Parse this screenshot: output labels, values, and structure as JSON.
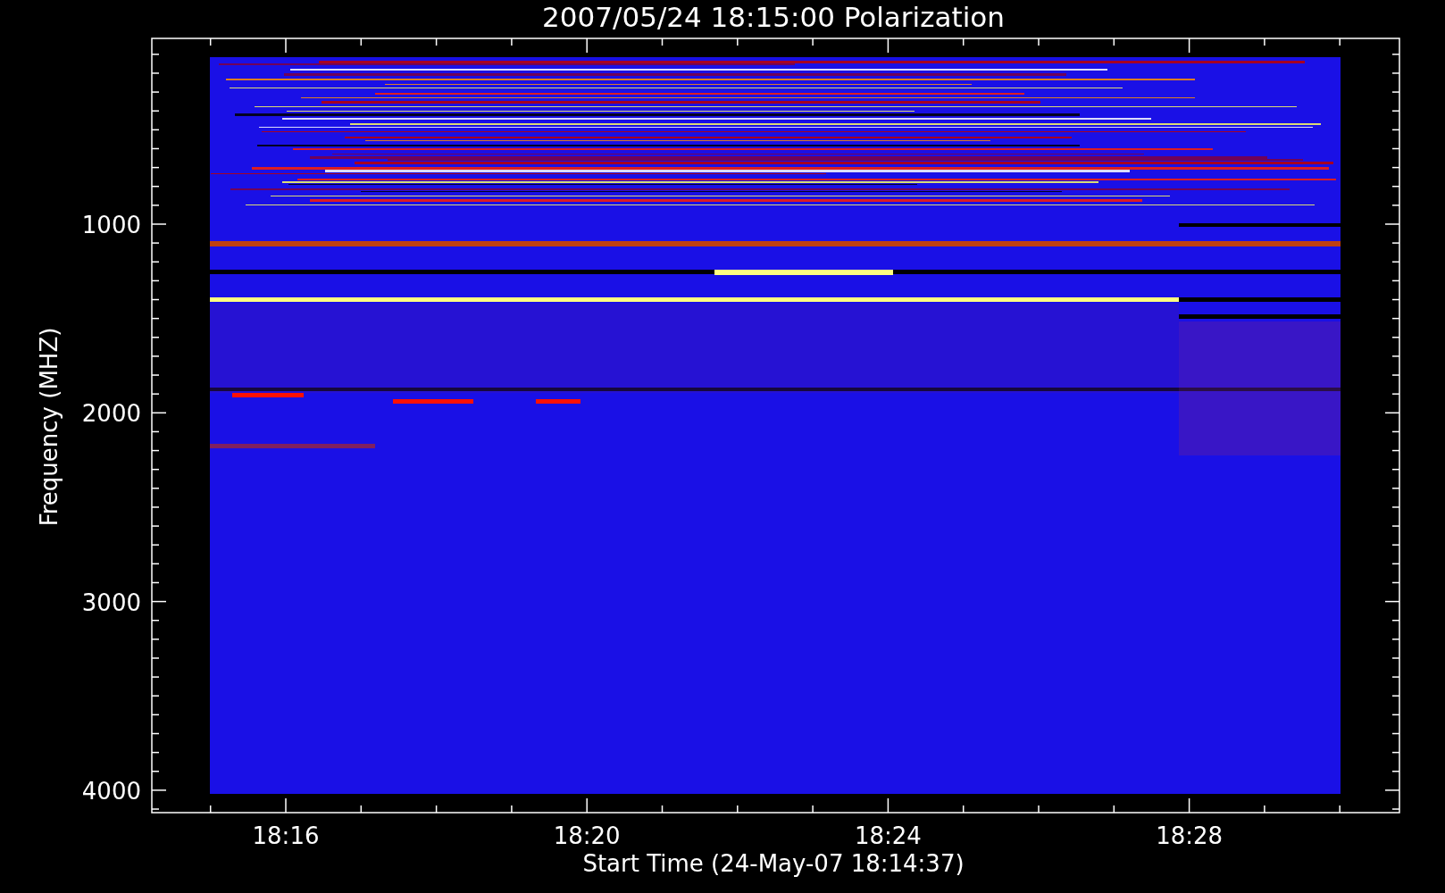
{
  "title": "2007/05/24 18:15:00 Polarization",
  "y_axis": {
    "label": "Frequency (MHZ)",
    "ticks": [
      "1000",
      "2000",
      "3000",
      "4000"
    ]
  },
  "x_axis": {
    "label": "Start Time (24-May-07 18:14:37)",
    "ticks": [
      "18:16",
      "18:20",
      "18:24",
      "18:28"
    ]
  }
}
